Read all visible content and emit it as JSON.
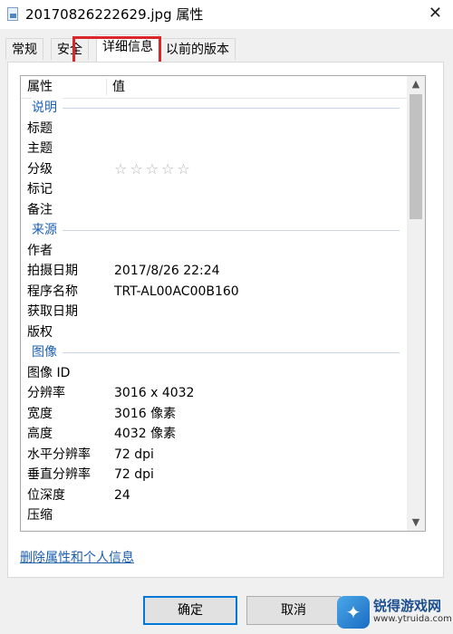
{
  "window": {
    "title": "20170826222629.jpg 属性",
    "close_glyph": "✕",
    "icon": "image-file-icon"
  },
  "tabs": [
    {
      "label": "常规",
      "active": false
    },
    {
      "label": "安全",
      "active": false
    },
    {
      "label": "详细信息",
      "active": true
    },
    {
      "label": "以前的版本",
      "active": false
    }
  ],
  "highlight_color": "#d8262b",
  "list": {
    "header": {
      "property": "属性",
      "value": "值"
    },
    "groups": [
      {
        "name": "说明",
        "rows": [
          {
            "name": "标题",
            "value": ""
          },
          {
            "name": "主题",
            "value": ""
          },
          {
            "name": "分级",
            "value": "",
            "stars": "☆☆☆☆☆"
          },
          {
            "name": "标记",
            "value": ""
          },
          {
            "name": "备注",
            "value": ""
          }
        ]
      },
      {
        "name": "来源",
        "rows": [
          {
            "name": "作者",
            "value": ""
          },
          {
            "name": "拍摄日期",
            "value": "2017/8/26 22:24"
          },
          {
            "name": "程序名称",
            "value": "TRT-AL00AC00B160"
          },
          {
            "name": "获取日期",
            "value": ""
          },
          {
            "name": "版权",
            "value": ""
          }
        ]
      },
      {
        "name": "图像",
        "rows": [
          {
            "name": "图像 ID",
            "value": ""
          },
          {
            "name": "分辨率",
            "value": "3016 x 4032"
          },
          {
            "name": "宽度",
            "value": "3016 像素"
          },
          {
            "name": "高度",
            "value": "4032 像素"
          },
          {
            "name": "水平分辨率",
            "value": "72 dpi"
          },
          {
            "name": "垂直分辨率",
            "value": "72 dpi"
          },
          {
            "name": "位深度",
            "value": "24"
          },
          {
            "name": "压缩",
            "value": ""
          }
        ]
      }
    ]
  },
  "link_label": "删除属性和个人信息",
  "buttons": {
    "ok": "确定",
    "cancel": "取消"
  },
  "watermark": {
    "title": "锐得游戏网",
    "url": "www.ytruida.com"
  }
}
